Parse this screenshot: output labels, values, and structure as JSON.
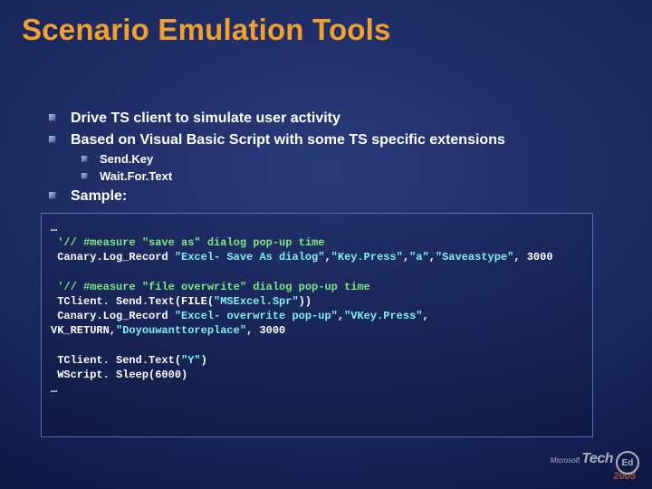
{
  "title": "Scenario Emulation Tools",
  "bullets": {
    "b1": "Drive TS client to simulate user activity",
    "b2": "Based on Visual Basic Script with some TS specific extensions",
    "sub1": "Send.Key",
    "sub2": "Wait.For.Text",
    "b3": "Sample:"
  },
  "code": {
    "ell1": "…",
    "c1": " '// #measure \"save as\" dialog pop-up time",
    "c2a": " Canary.Log_Record ",
    "c2b": "\"Excel- Save As dialog\"",
    "c2c": ",",
    "c2d": "\"Key.Press\"",
    "c2e": ",",
    "c2f": "\"a\"",
    "c2g": ",",
    "c2h": "\"Saveastype\"",
    "c2i": ", 3000",
    "c3": " '// #measure \"file overwrite\" dialog pop-up time",
    "c4a": " TClient. Send.Text(FILE(",
    "c4b": "\"MSExcel.Spr\"",
    "c4c": "))",
    "c5a": " Canary.Log_Record ",
    "c5b": "\"Excel- overwrite pop-up\"",
    "c5c": ",",
    "c5d": "\"VKey.Press\"",
    "c5e": ", VK_RETURN,",
    "c5f": "\"Doyouwanttoreplace\"",
    "c5g": ", 3000",
    "c6a": " TClient. Send.Text(",
    "c6b": "\"Y\"",
    "c6c": ")",
    "c7": " WScript. Sleep(6000)",
    "ell2": "…"
  },
  "logo": {
    "ms": "Microsoft",
    "tech": "Tech",
    "ed": "Ed",
    "year": "2005"
  }
}
